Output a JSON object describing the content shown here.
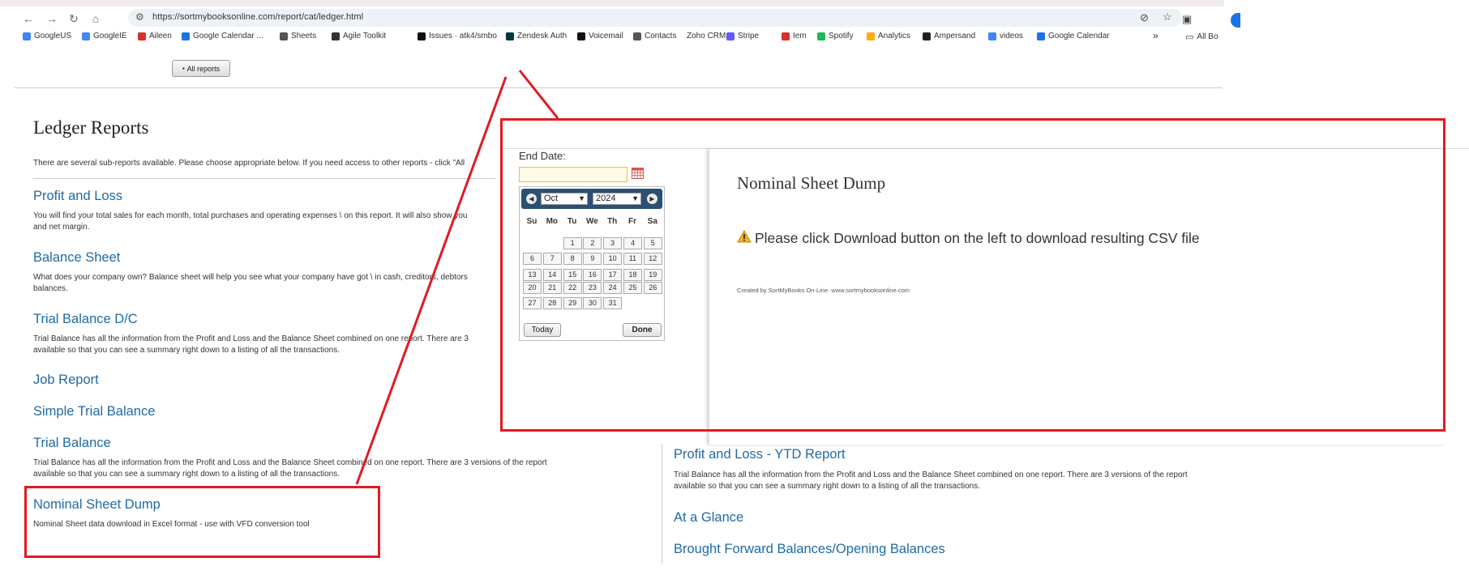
{
  "browser": {
    "url": "https://sortmybooksonline.com/report/cat/ledger.html",
    "bookmarks": [
      {
        "label": "GoogleUS",
        "icon": "google-icon",
        "color": "#4285f4"
      },
      {
        "label": "GoogleIE",
        "icon": "google-icon",
        "color": "#4285f4"
      },
      {
        "label": "Aileen",
        "icon": "gmail-icon",
        "color": "#d93025"
      },
      {
        "label": "Google Calendar ...",
        "icon": "calendar-icon",
        "color": "#1a73e8"
      },
      {
        "label": "Sheets",
        "icon": "globe-icon",
        "color": "#555555"
      },
      {
        "label": "Agile Toolkit",
        "icon": "gear-icon",
        "color": "#333333"
      },
      {
        "label": "Issues · atk4/smbo",
        "icon": "github-icon",
        "color": "#111111"
      },
      {
        "label": "Zendesk Auth",
        "icon": "zendesk-icon",
        "color": "#03363d"
      },
      {
        "label": "Voicemail",
        "icon": "voicemail-icon",
        "color": "#111111"
      },
      {
        "label": "Contacts",
        "icon": "contacts-icon",
        "color": "#555555"
      },
      {
        "label": "Zoho CRM",
        "icon": "",
        "color": ""
      },
      {
        "label": "Stripe",
        "icon": "stripe-icon",
        "color": "#635bff"
      },
      {
        "label": "Iem",
        "icon": "gmail-icon",
        "color": "#d93025"
      },
      {
        "label": "Spotify",
        "icon": "spotify-icon",
        "color": "#1db954"
      },
      {
        "label": "Analytics",
        "icon": "analytics-icon",
        "color": "#f9ab00"
      },
      {
        "label": "Ampersand",
        "icon": "ampersand-icon",
        "color": "#222222"
      },
      {
        "label": "videos",
        "icon": "google-icon",
        "color": "#4285f4"
      },
      {
        "label": "Google Calendar",
        "icon": "calendar-icon",
        "color": "#1a73e8"
      }
    ],
    "more_label": "»",
    "all_bookmarks_label": "All Bo"
  },
  "page": {
    "all_reports_button": "All reports",
    "title": "Ledger Reports",
    "intro": "There are several sub-reports available. Please choose appropriate below. If you need access to other reports - click \"All",
    "reports": [
      {
        "title": "Profit and Loss",
        "desc": "You will find your total sales for each month, total purchases and operating expenses \\ on this report. It will also show you\nand net margin."
      },
      {
        "title": "Balance Sheet",
        "desc": "What does your company own? Balance sheet will help you see what your company have got \\ in cash, creditors, debtors\nbalances."
      },
      {
        "title": "Trial Balance D/C",
        "desc": "Trial Balance has all the information from the Profit and Loss and the Balance Sheet combined on one report. There are 3\navailable so that you can see a summary right down to a listing of all the transactions."
      },
      {
        "title": "Job Report",
        "desc": ""
      },
      {
        "title": "Simple Trial Balance",
        "desc": ""
      },
      {
        "title": "Trial Balance",
        "desc": "Trial Balance has all the information from the Profit and Loss and the Balance Sheet combined on one report. There are 3 versions of the report\navailable so that you can see a summary right down to a listing of all the transactions."
      },
      {
        "title": "Nominal Sheet Dump",
        "desc": "Nominal Sheet data download in Excel format - use with VFD conversion tool"
      }
    ],
    "right_reports": [
      {
        "title": "Profit and Loss - YTD Report",
        "desc": "Trial Balance has all the information from the Profit and Loss and the Balance Sheet combined on one report. There are 3 versions of the report\navailable so that you can see a summary right down to a listing of all the transactions."
      },
      {
        "title": "At a Glance",
        "desc": ""
      },
      {
        "title": "Brought Forward Balances/Opening Balances",
        "desc": ""
      }
    ]
  },
  "zoom": {
    "end_date_label": "End Date:",
    "datepicker": {
      "month": "Oct",
      "year": "2024",
      "weekdays": [
        "Su",
        "Mo",
        "Tu",
        "We",
        "Th",
        "Fr",
        "Sa"
      ],
      "first_weekday": 2,
      "days_in_month": 31,
      "today_button": "Today",
      "done_button": "Done"
    },
    "result": {
      "title": "Nominal Sheet Dump",
      "message": "Please click Download button on the left to download resulting CSV file",
      "credit": "Created by SortMyBooks On-Line. www.sortmybooksonline.com"
    }
  },
  "colors": {
    "callout": "#e01b22",
    "link": "#1f6aa5",
    "datepicker_header": "#2c4f74"
  }
}
